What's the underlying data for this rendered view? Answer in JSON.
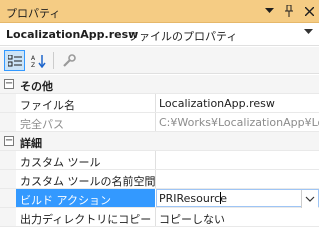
{
  "window": {
    "title": "プロパティ"
  },
  "object_bar": {
    "name": "LocalizationApp.resw",
    "type": "ファイルのプロパティ"
  },
  "categories": {
    "misc": "その他",
    "advanced": "詳細"
  },
  "properties": {
    "file_name": {
      "label": "ファイル名",
      "value": "LocalizationApp.resw"
    },
    "full_path": {
      "label": "完全パス",
      "value": "C:¥Works¥LocalizationApp¥Lo"
    },
    "custom_tool": {
      "label": "カスタム ツール",
      "value": ""
    },
    "custom_tool_ns": {
      "label": "カスタム ツールの名前空間",
      "value": ""
    },
    "build_action": {
      "label": "ビルド アクション",
      "value": "PRIResource"
    },
    "copy_to_output": {
      "label": "出力ディレクトリにコピー",
      "value": "コピーしない"
    }
  },
  "colors": {
    "titlebar": "#f5cc84",
    "selection": "#3399ff"
  }
}
